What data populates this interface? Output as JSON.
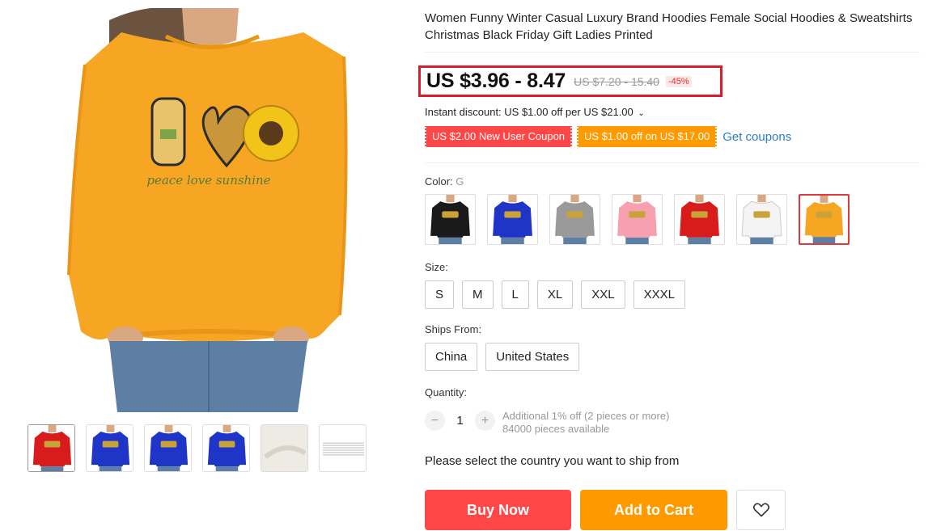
{
  "product": {
    "title": "Women Funny Winter Casual Luxury Brand Hoodies Female Social Hoodies & Sweatshirts Christmas Black Friday Gift Ladies Printed",
    "main_image_text": "peace love sunshine"
  },
  "price": {
    "current": "US $3.96 - 8.47",
    "original": "US $7.20 - 15.40",
    "discount": "-45%"
  },
  "instant_discount": {
    "text": "Instant discount: US $1.00 off per US $21.00",
    "chevron": "⌄"
  },
  "coupons": {
    "items": [
      "US $2.00 New User Coupon",
      "US $1.00 off on US $17.00"
    ],
    "get_label": "Get coupons"
  },
  "color": {
    "label": "Color: ",
    "selected": "G",
    "swatches": [
      {
        "color": "#1a1a1a"
      },
      {
        "color": "#1f35c8"
      },
      {
        "color": "#9a9a9a"
      },
      {
        "color": "#f7a0b0"
      },
      {
        "color": "#d81c1c"
      },
      {
        "color": "#f4f4f4"
      },
      {
        "color": "#f7a623"
      }
    ]
  },
  "size": {
    "label": "Size:",
    "options": [
      "S",
      "M",
      "L",
      "XL",
      "XXL",
      "XXXL"
    ]
  },
  "ships_from": {
    "label": "Ships From:",
    "options": [
      "China",
      "United States"
    ]
  },
  "quantity": {
    "label": "Quantity:",
    "value": "1",
    "minus": "−",
    "plus": "+",
    "promo": "Additional 1% off (2 pieces or more)",
    "available": "84000 pieces available"
  },
  "ship_notice": "Please select the country you want to ship from",
  "actions": {
    "buy_now": "Buy Now",
    "add_to_cart": "Add to Cart",
    "wishlist_icon": "heart-icon"
  },
  "thumbnails": [
    {
      "color": "#d81c1c",
      "icon": "multi-color-thumbnail"
    },
    {
      "color": "#1f35c8",
      "icon": "blue-shirt-thumbnail"
    },
    {
      "color": "#1f35c8",
      "icon": "blue-shirt-back-thumbnail"
    },
    {
      "color": "#1f35c8",
      "icon": "blue-shirt-worn-thumbnail"
    },
    {
      "color": "#eeeae4",
      "icon": "fabric-detail-thumbnail"
    },
    {
      "color": "#ffffff",
      "icon": "size-chart-thumbnail"
    }
  ]
}
